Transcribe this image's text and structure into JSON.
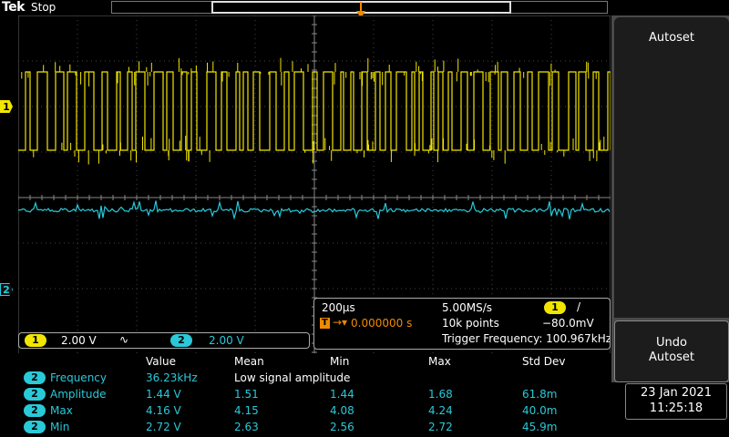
{
  "header": {
    "brand": "Tek",
    "acquisition_state": "Stop"
  },
  "markers": {
    "ch1": "1",
    "ch2": "2",
    "trigger": "T"
  },
  "channels": [
    {
      "badge": "1",
      "scale": "2.00 V",
      "coupling_icon": "∿",
      "color": "#f2e600"
    },
    {
      "badge": "2",
      "scale": "2.00 V",
      "color": "#29c9d8"
    }
  ],
  "horizontal": {
    "time_per_div": "200µs",
    "trigger_position": "0.000000 s",
    "trigger_position_prefix": "T",
    "sample_rate": "5.00MS/s",
    "record_length": "10k points",
    "trigger_source": "1",
    "trigger_slope": "/",
    "trigger_level": "−80.0mV",
    "trigger_frequency": "Trigger Frequency: 100.967kHz"
  },
  "measurements": {
    "headers": [
      "Value",
      "Mean",
      "Min",
      "Max",
      "Std Dev"
    ],
    "rows": [
      {
        "channel": "2",
        "name": "Frequency",
        "value": "36.23kHz",
        "mean": "Low signal amplitude",
        "min": "",
        "max": "",
        "std": ""
      },
      {
        "channel": "2",
        "name": "Amplitude",
        "value": "1.44 V",
        "mean": "1.51",
        "min": "1.44",
        "max": "1.68",
        "std": "61.8m"
      },
      {
        "channel": "2",
        "name": "Max",
        "value": "4.16 V",
        "mean": "4.15",
        "min": "4.08",
        "max": "4.24",
        "std": "40.0m"
      },
      {
        "channel": "2",
        "name": "Min",
        "value": "2.72 V",
        "mean": "2.63",
        "min": "2.56",
        "max": "2.72",
        "std": "45.9m"
      }
    ]
  },
  "menu": {
    "autoset": "Autoset",
    "undo_line1": "Undo",
    "undo_line2": "Autoset"
  },
  "datetime": {
    "date": "23 Jan  2021",
    "time": "11:25:18"
  },
  "colors": {
    "ch1": "#f2e600",
    "ch2": "#29c9d8",
    "trigger": "#f08a00",
    "menu_bg": "#4a4a4a"
  }
}
